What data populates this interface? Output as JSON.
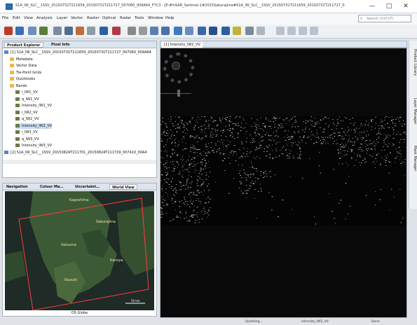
{
  "window": {
    "title": "S1A_IW_SLC__1SSV_20150731T211659_20150731T211727_007060_009A64_F7C3 - [E:#InSAR_Sentinel-1#2015Sakurajima#S1A_IW_SLC__1SSV_20150731T211659_20150731T211727_007060_0…",
    "min_glyph": "—",
    "max_glyph": "□",
    "close_glyph": "✕"
  },
  "menu": [
    "File",
    "Edit",
    "View",
    "Analysis",
    "Layer",
    "Vector",
    "Raster",
    "Optical",
    "Radar",
    "Tools",
    "Window",
    "Help"
  ],
  "search": {
    "placeholder": "Search (Ctrl+F)"
  },
  "left_panel": {
    "tabs": [
      "Product Explorer",
      "Pixel Info"
    ],
    "tree": [
      {
        "label": "[1] S1A_IW_SLC__1SSV_20150731T211659_20150731T211727_007060_009A64",
        "icon": "prod",
        "indent": 0
      },
      {
        "label": "Metadata",
        "icon": "folder",
        "indent": 1
      },
      {
        "label": "Vector Data",
        "icon": "folder",
        "indent": 1
      },
      {
        "label": "Tie-Point Grids",
        "icon": "folder",
        "indent": 1
      },
      {
        "label": "Quicklooks",
        "icon": "folder",
        "indent": 1
      },
      {
        "label": "Bands",
        "icon": "folder",
        "indent": 1
      },
      {
        "label": "i_IW1_VV",
        "icon": "band",
        "indent": 2
      },
      {
        "label": "q_IW1_VV",
        "icon": "band",
        "indent": 2
      },
      {
        "label": "Intensity_IW1_VV",
        "icon": "band",
        "indent": 2
      },
      {
        "label": "i_IW2_VV",
        "icon": "band",
        "indent": 2
      },
      {
        "label": "q_IW2_VV",
        "icon": "band",
        "indent": 2
      },
      {
        "label": "Intensity_IW2_VV",
        "icon": "band",
        "indent": 2,
        "selected": true
      },
      {
        "label": "i_IW3_VV",
        "icon": "band",
        "indent": 2
      },
      {
        "label": "q_IW3_VV",
        "icon": "band",
        "indent": 2
      },
      {
        "label": "Intensity_IW3_VV",
        "icon": "band",
        "indent": 2
      },
      {
        "label": "[2] S1A_IW_SLC__1SSV_20150824T211701_20150824T211729_007410_00A4",
        "icon": "prod",
        "indent": 0
      }
    ],
    "bottom_tabs": [
      "Navigation",
      "Colour Ma…",
      "Uncertaint…",
      "World View"
    ],
    "world_view_labels": [
      "Kagoshima",
      "Satsuma",
      "Sakurajima",
      "Kanoya",
      "Ibusuki"
    ],
    "globe_label": "OS Globe",
    "scale_label": "50 km"
  },
  "image_view": {
    "tab_label": "[1] Intensity_IW2_VV"
  },
  "right_dock": [
    "Product Library",
    "Layer Manager",
    "Mask Manager"
  ],
  "status": [
    "Updating…",
    "Intensity_IW2_VV",
    "Done"
  ]
}
